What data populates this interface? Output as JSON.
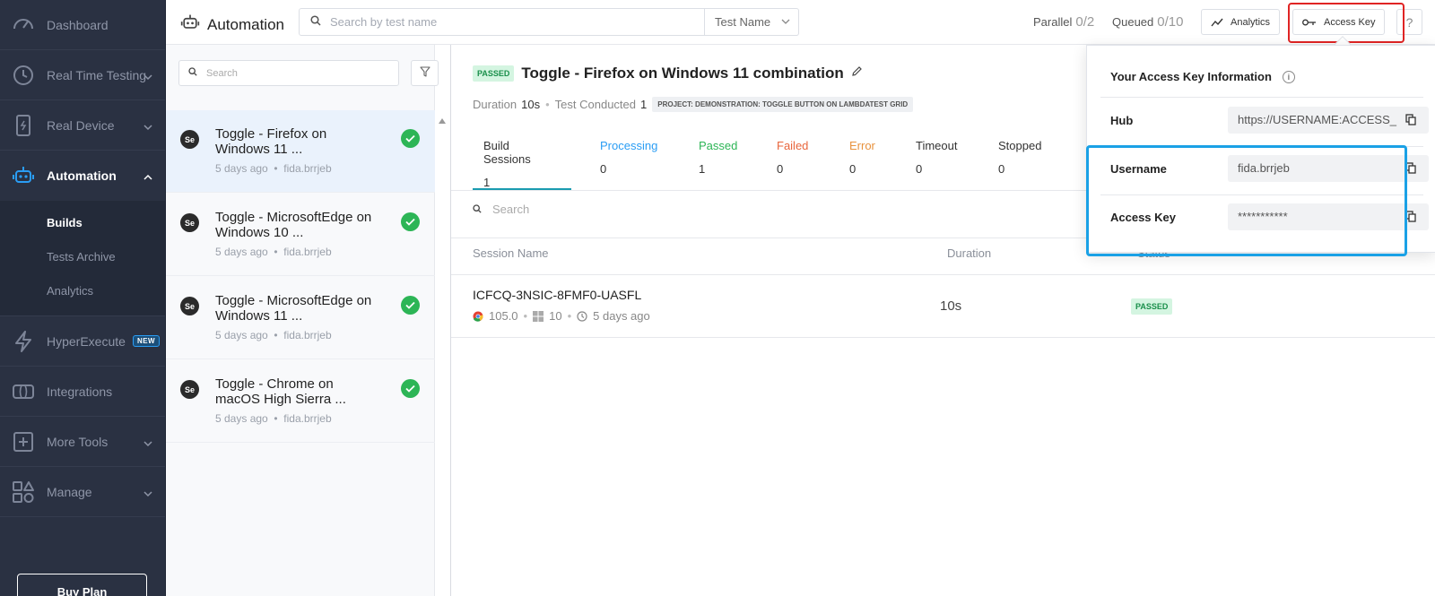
{
  "sidebar": {
    "items": [
      {
        "label": "Dashboard",
        "icon": "dashboard-icon"
      },
      {
        "label": "Real Time Testing",
        "icon": "clock-icon"
      },
      {
        "label": "Real Device",
        "icon": "device-icon"
      },
      {
        "label": "Automation",
        "icon": "robot-icon"
      },
      {
        "label": "HyperExecute",
        "icon": "lightning-icon",
        "badge": "NEW"
      },
      {
        "label": "Integrations",
        "icon": "integrations-icon"
      },
      {
        "label": "More Tools",
        "icon": "plus-box-icon"
      },
      {
        "label": "Manage",
        "icon": "shapes-icon"
      }
    ],
    "automation_sub": [
      "Builds",
      "Tests Archive",
      "Analytics"
    ],
    "buy_button": "Buy Plan"
  },
  "header": {
    "title": "Automation",
    "search_placeholder": "Search by test name",
    "search_type": "Test Name",
    "parallel_label": "Parallel",
    "parallel_value": "0/2",
    "queued_label": "Queued",
    "queued_value": "0/10",
    "analytics_btn": "Analytics",
    "access_key_btn": "Access Key",
    "help": "?"
  },
  "builds": {
    "search_placeholder": "Search",
    "items": [
      {
        "name": "Toggle - Firefox on Windows 11 ...",
        "time": "5 days ago",
        "user": "fida.brrjeb",
        "se": "Se"
      },
      {
        "name": "Toggle - MicrosoftEdge on Windows 10 ...",
        "time": "5 days ago",
        "user": "fida.brrjeb",
        "se": "Se"
      },
      {
        "name": "Toggle - MicrosoftEdge on Windows 11 ...",
        "time": "5 days ago",
        "user": "fida.brrjeb",
        "se": "Se"
      },
      {
        "name": "Toggle - Chrome on macOS High Sierra ...",
        "time": "5 days ago",
        "user": "fida.brrjeb",
        "se": "Se"
      }
    ]
  },
  "build_detail": {
    "status": "PASSED",
    "title": "Toggle - Firefox on Windows 11 combination",
    "duration_label": "Duration",
    "duration_value": "10s",
    "conducted_label": "Test Conducted",
    "conducted_value": "1",
    "project_tag": "PROJECT: DEMONSTRATION: TOGGLE BUTTON ON LAMBDATEST GRID",
    "tabs": [
      {
        "label": "Build Sessions",
        "count": "1",
        "color": "#222222"
      },
      {
        "label": "Processing",
        "count": "0",
        "color": "#2a9df4"
      },
      {
        "label": "Passed",
        "count": "1",
        "color": "#2db556"
      },
      {
        "label": "Failed",
        "count": "0",
        "color": "#e8663d"
      },
      {
        "label": "Error",
        "count": "0",
        "color": "#e8923d"
      },
      {
        "label": "Timeout",
        "count": "0",
        "color": "#333333"
      },
      {
        "label": "Stopped",
        "count": "0",
        "color": "#333333"
      }
    ],
    "session_search_placeholder": "Search",
    "columns": {
      "name": "Session Name",
      "duration": "Duration",
      "status": "Status"
    },
    "sessions": [
      {
        "name": "ICFCQ-3NSIC-8FMF0-UASFL",
        "browser_version": "105.0",
        "os_version": "10",
        "time": "5 days ago",
        "duration": "10s",
        "status": "PASSED"
      }
    ]
  },
  "access_popover": {
    "title": "Your Access Key Information",
    "info": "i",
    "hub_label": "Hub",
    "hub_value": "https://USERNAME:ACCESS_",
    "username_label": "Username",
    "username_value": "fida.brrjeb",
    "key_label": "Access Key",
    "key_value": "***********"
  },
  "colors": {
    "sidebar_bg": "#2a3142",
    "accent_teal": "#1a9bb0",
    "success": "#2db556",
    "highlight_red": "#e02424",
    "highlight_blue": "#1aa1e6"
  }
}
